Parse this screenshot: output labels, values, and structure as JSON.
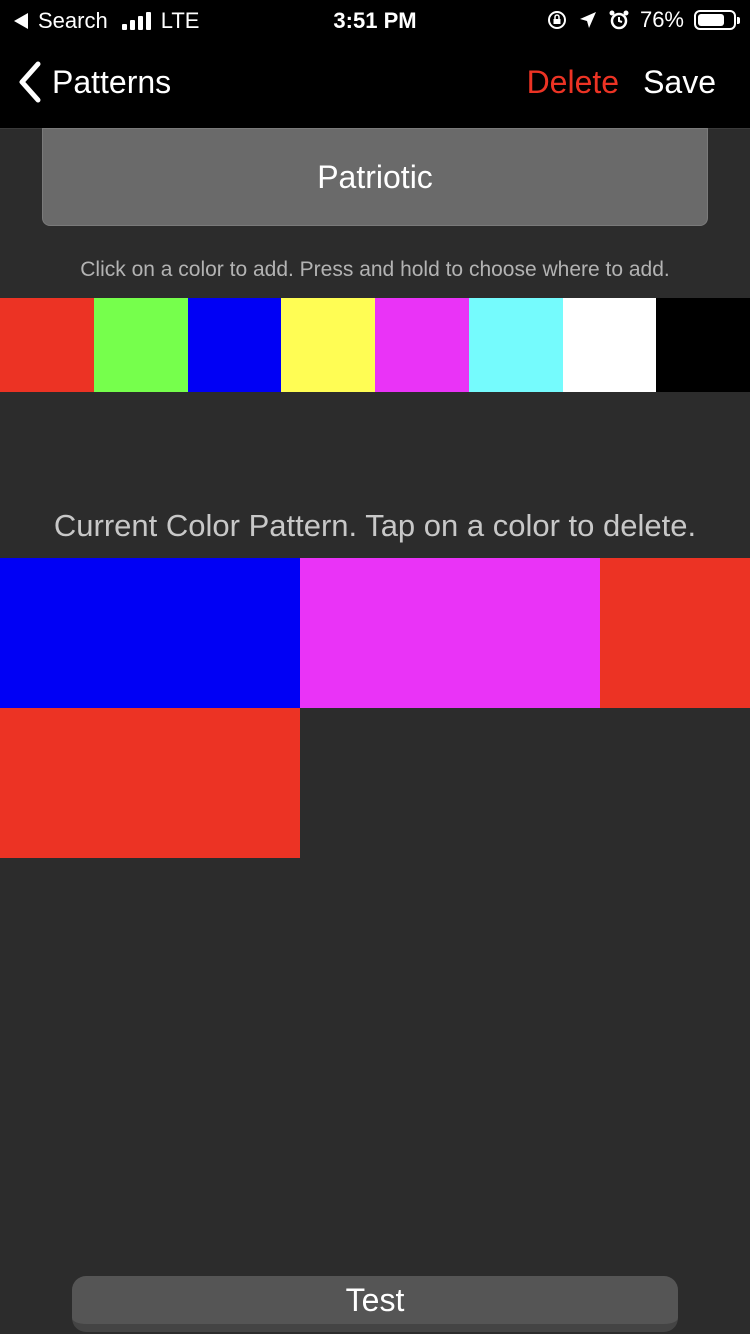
{
  "status_bar": {
    "back_app": "Search",
    "network": "LTE",
    "time": "3:51 PM",
    "battery_percent": "76%",
    "battery_level": 0.76
  },
  "nav": {
    "back_label": "Patterns",
    "delete_label": "Delete",
    "save_label": "Save"
  },
  "pattern_name": "Patriotic",
  "hint": "Click on a color to add. Press and hold to choose where to add.",
  "palette": [
    {
      "name": "red",
      "color": "#ec3324"
    },
    {
      "name": "green",
      "color": "#76ff4c"
    },
    {
      "name": "blue",
      "color": "#0000f5"
    },
    {
      "name": "yellow",
      "color": "#fffd54"
    },
    {
      "name": "magenta",
      "color": "#ea33f7"
    },
    {
      "name": "cyan",
      "color": "#75fbfd"
    },
    {
      "name": "white",
      "color": "#ffffff"
    },
    {
      "name": "black",
      "color": "#000000"
    }
  ],
  "current_label": "Current Color Pattern. Tap on a color to delete.",
  "current_pattern": [
    {
      "name": "blue",
      "color": "#0000f5"
    },
    {
      "name": "magenta",
      "color": "#ea33f7"
    },
    {
      "name": "red",
      "color": "#ec3324"
    },
    {
      "name": "red",
      "color": "#ec3324"
    }
  ],
  "test_label": "Test"
}
